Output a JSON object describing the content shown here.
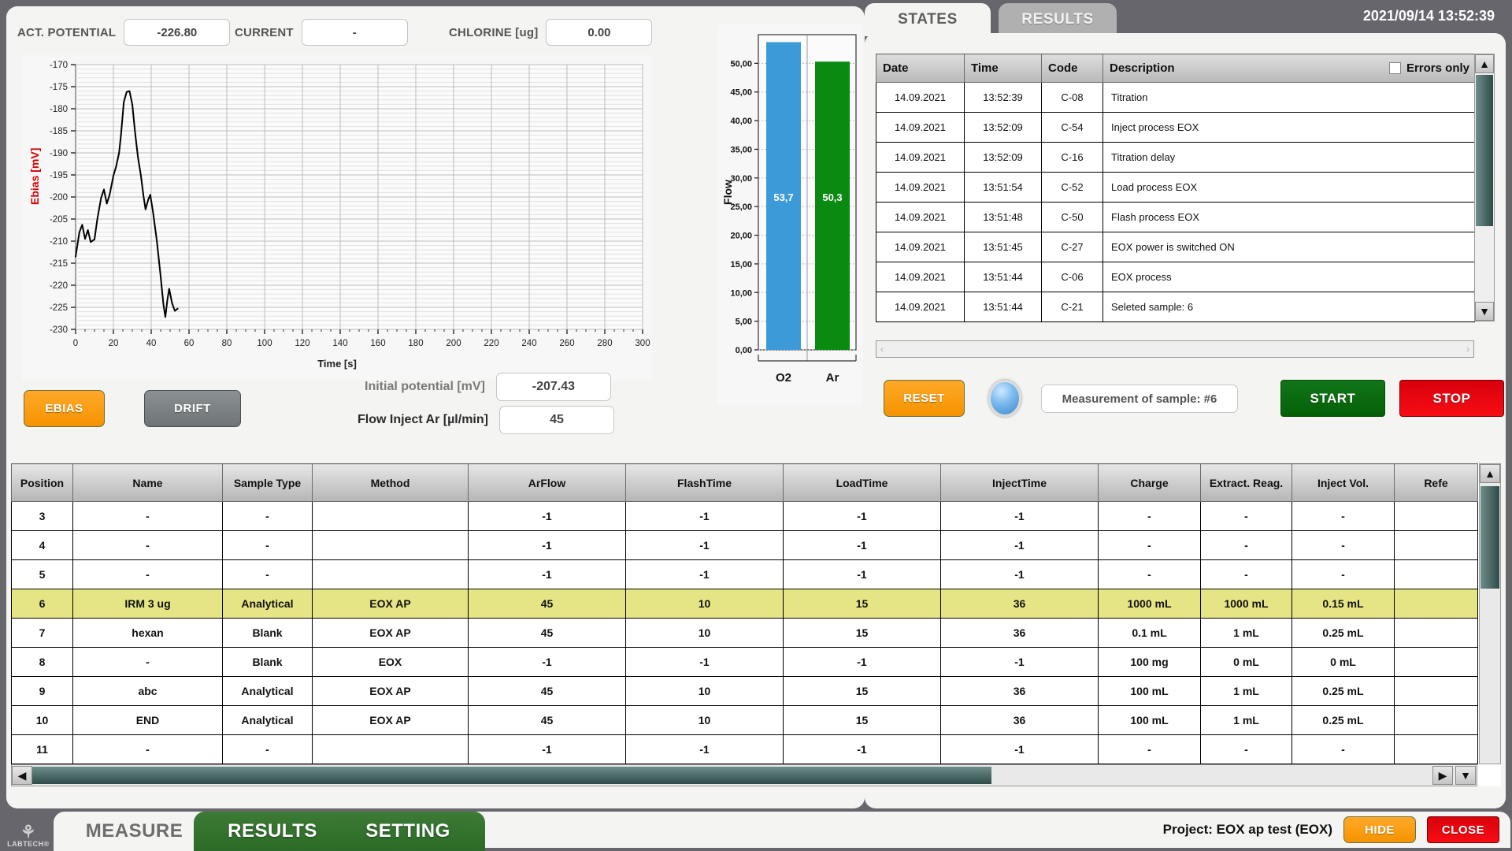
{
  "header": {
    "readouts": [
      {
        "label": "ACT. POTENTIAL",
        "value": "-226.80"
      },
      {
        "label": "CURRENT",
        "value": "-"
      },
      {
        "label": "CHLORINE [ug]",
        "value": "0.00"
      }
    ],
    "clock": "2021/09/14  13:52:39"
  },
  "tabs_top": [
    {
      "label": "STATES",
      "active": true
    },
    {
      "label": "RESULTS",
      "active": false
    }
  ],
  "controls": {
    "ebias_label": "EBIAS",
    "drift_label": "DRIFT",
    "initial_potential_label": "Initial potential [mV]",
    "initial_potential_value": "-207.43",
    "flow_inject_label": "Flow Inject Ar [µl/min]",
    "flow_inject_value": "45",
    "reset_label": "RESET",
    "status_text": "Measurement of sample: #6",
    "start_label": "START",
    "stop_label": "STOP"
  },
  "states": {
    "columns": [
      "Date",
      "Time",
      "Code",
      "Description"
    ],
    "errors_only_label": "Errors only",
    "rows": [
      {
        "date": "14.09.2021",
        "time": "13:52:39",
        "code": "C-08",
        "description": "Titration"
      },
      {
        "date": "14.09.2021",
        "time": "13:52:09",
        "code": "C-54",
        "description": "Inject process EOX"
      },
      {
        "date": "14.09.2021",
        "time": "13:52:09",
        "code": "C-16",
        "description": "Titration delay"
      },
      {
        "date": "14.09.2021",
        "time": "13:51:54",
        "code": "C-52",
        "description": "Load process EOX"
      },
      {
        "date": "14.09.2021",
        "time": "13:51:48",
        "code": "C-50",
        "description": "Flash process EOX"
      },
      {
        "date": "14.09.2021",
        "time": "13:51:45",
        "code": "C-27",
        "description": "EOX power is switched ON"
      },
      {
        "date": "14.09.2021",
        "time": "13:51:44",
        "code": "C-06",
        "description": "EOX process"
      },
      {
        "date": "14.09.2021",
        "time": "13:51:44",
        "code": "C-21",
        "description": "Seleted sample: 6"
      }
    ]
  },
  "sample_table": {
    "columns": [
      "Position",
      "Name",
      "Sample Type",
      "Method",
      "ArFlow",
      "FlashTime",
      "LoadTime",
      "InjectTime",
      "Charge",
      "Extract. Reag.",
      "Inject Vol.",
      "Refe"
    ],
    "rows": [
      {
        "highlight": false,
        "cells": [
          "3",
          "-",
          "-",
          "",
          "-1",
          "-1",
          "-1",
          "-1",
          "-",
          "-",
          "-",
          ""
        ]
      },
      {
        "highlight": false,
        "cells": [
          "4",
          "-",
          "-",
          "",
          "-1",
          "-1",
          "-1",
          "-1",
          "-",
          "-",
          "-",
          ""
        ]
      },
      {
        "highlight": false,
        "cells": [
          "5",
          "-",
          "-",
          "",
          "-1",
          "-1",
          "-1",
          "-1",
          "-",
          "-",
          "-",
          ""
        ]
      },
      {
        "highlight": true,
        "cells": [
          "6",
          "IRM 3 ug",
          "Analytical",
          "EOX AP",
          "45",
          "10",
          "15",
          "36",
          "1000 mL",
          "1000 mL",
          "0.15 mL",
          ""
        ]
      },
      {
        "highlight": false,
        "cells": [
          "7",
          "hexan",
          "Blank",
          "EOX AP",
          "45",
          "10",
          "15",
          "36",
          "0.1 mL",
          "1 mL",
          "0.25 mL",
          ""
        ]
      },
      {
        "highlight": false,
        "cells": [
          "8",
          "-",
          "Blank",
          "EOX",
          "-1",
          "-1",
          "-1",
          "-1",
          "100 mg",
          "0 mL",
          "0 mL",
          ""
        ]
      },
      {
        "highlight": false,
        "cells": [
          "9",
          "abc",
          "Analytical",
          "EOX AP",
          "45",
          "10",
          "15",
          "36",
          "100 mL",
          "1 mL",
          "0.25 mL",
          ""
        ]
      },
      {
        "highlight": false,
        "cells": [
          "10",
          "END",
          "Analytical",
          "EOX AP",
          "45",
          "10",
          "15",
          "36",
          "100 mL",
          "1 mL",
          "0.25 mL",
          ""
        ]
      },
      {
        "highlight": false,
        "cells": [
          "11",
          "-",
          "-",
          "",
          "-1",
          "-1",
          "-1",
          "-1",
          "-",
          "-",
          "-",
          ""
        ]
      }
    ]
  },
  "footer": {
    "logo_text": "LABTECH®",
    "tabs": [
      {
        "label": "MEASURE",
        "active": true
      },
      {
        "label": "RESULTS",
        "active": false
      },
      {
        "label": "SETTING",
        "active": false
      }
    ],
    "project": "Project: EOX ap test (EOX)",
    "hide_label": "HIDE",
    "close_label": "CLOSE"
  },
  "colors": {
    "o2_bar": "#3d9ad9",
    "ar_bar": "#0a8a11",
    "accent_orange": "#f59300",
    "start_green": "#0a6b0c",
    "stop_red": "#e00810",
    "highlight_row": "#e5e585",
    "ebias_axis_label": "#d40000"
  },
  "chart_data": [
    {
      "type": "line",
      "title": "",
      "xlabel": "Time [s]",
      "ylabel": "Ebias [mV]",
      "xlim": [
        0,
        300
      ],
      "ylim": [
        -230,
        -170
      ],
      "xticks": [
        0,
        20,
        40,
        60,
        80,
        100,
        120,
        140,
        160,
        180,
        200,
        220,
        240,
        260,
        280,
        300
      ],
      "yticks": [
        -170,
        -175,
        -180,
        -185,
        -190,
        -195,
        -200,
        -205,
        -210,
        -215,
        -220,
        -225,
        -230
      ],
      "grid": true,
      "legend": "none",
      "series": [
        {
          "name": "Ebias",
          "color": "#000000",
          "points": [
            [
              0,
              -213.5
            ],
            [
              2,
              -208.0
            ],
            [
              3.5,
              -206.3
            ],
            [
              5,
              -209.5
            ],
            [
              6.5,
              -207.5
            ],
            [
              8,
              -210.2
            ],
            [
              10,
              -209.6
            ],
            [
              11.5,
              -205.0
            ],
            [
              13.5,
              -200.2
            ],
            [
              15,
              -198.3
            ],
            [
              16.5,
              -201.5
            ],
            [
              18,
              -199.5
            ],
            [
              20,
              -195.2
            ],
            [
              21.5,
              -193.0
            ],
            [
              23,
              -190.0
            ],
            [
              24,
              -186.0
            ],
            [
              25.5,
              -178.5
            ],
            [
              27,
              -176.2
            ],
            [
              28.5,
              -176.0
            ],
            [
              30,
              -179.0
            ],
            [
              31.5,
              -185.5
            ],
            [
              33,
              -191.0
            ],
            [
              34.5,
              -195.0
            ],
            [
              36,
              -200.0
            ],
            [
              37,
              -202.8
            ],
            [
              38.5,
              -200.5
            ],
            [
              39.5,
              -199.5
            ],
            [
              41,
              -203.5
            ],
            [
              43,
              -210.0
            ],
            [
              45,
              -218.0
            ],
            [
              46.5,
              -224.5
            ],
            [
              47.5,
              -227.2
            ],
            [
              48.5,
              -223.5
            ],
            [
              49.5,
              -220.8
            ],
            [
              51,
              -224.0
            ],
            [
              52.5,
              -225.8
            ],
            [
              54,
              -225.3
            ]
          ]
        }
      ]
    },
    {
      "type": "bar",
      "title": "",
      "xlabel": "",
      "ylabel": "Flow",
      "categories": [
        "O2",
        "Ar"
      ],
      "values": [
        53.7,
        50.3
      ],
      "value_labels": [
        "53,7",
        "50,3"
      ],
      "colors": [
        "#3d9ad9",
        "#0a8a11"
      ],
      "ylim": [
        0,
        55
      ],
      "yticks": [
        0,
        5,
        10,
        15,
        20,
        25,
        30,
        35,
        40,
        45,
        50
      ],
      "ytick_labels": [
        "0,00",
        "5,00",
        "10,00",
        "15,00",
        "20,00",
        "25,00",
        "30,00",
        "35,00",
        "40,00",
        "45,00",
        "50,00"
      ],
      "grid": true,
      "legend": "none"
    }
  ]
}
